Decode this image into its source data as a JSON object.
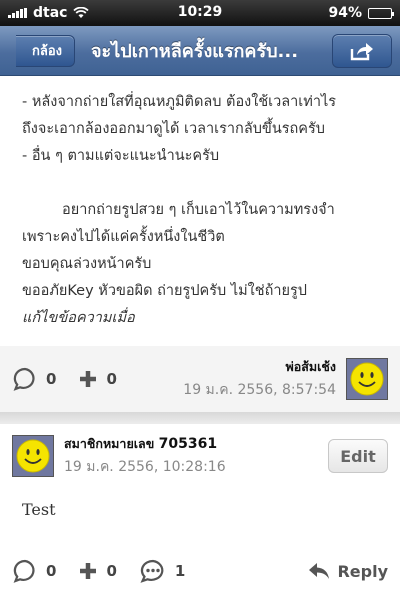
{
  "status_bar": {
    "carrier": "dtac",
    "time": "10:29",
    "battery": "94%",
    "battery_level": 0.94
  },
  "nav": {
    "back_label": "กล้อง",
    "title": "จะไปเกาหลีครั้งแรกครับ..."
  },
  "post": {
    "lines": [
      "- หลังจากถ่ายใสที่อุณหภูมิติดลบ ต้องใช้เวลาเท่าไร",
      "ถึงจะเอากล้องออกมาดูได้ เวลาเรากลับขึ้นรถครับ",
      "- อื่น ๆ ตามแต่จะแนะนำนะครับ"
    ],
    "lines2": [
      "อยากถ่ายรูปสวย ๆ เก็บเอาไว้ในความทรงจำ",
      "เพราะคงไปได้แค่ครั้งหนึ่งในชีวิต",
      "ขอบคุณล่วงหน้าครับ",
      "ขออภัยKey หัวขอผิด ถ่ายรูปครับ ไม่ใช่ถ้ายรูป"
    ],
    "edited_note": "แก้ไขข้อความเมื่อ",
    "comment_count": "0",
    "plus_count": "0",
    "author": "พ่อส้มเช้ง",
    "timestamp": "19 ม.ค. 2556, 8:57:54"
  },
  "comment": {
    "author_prefix": "สมาชิกหมายเลข",
    "author_number": "705361",
    "timestamp": "19 ม.ค. 2556, 10:28:16",
    "edit_label": "Edit",
    "text": "Test",
    "comment_count": "0",
    "plus_count": "0",
    "reply_count": "1",
    "reply_label": "Reply"
  },
  "colors": {
    "nav_blue": "#4c6d9e",
    "avatar_yellow": "#f5e400",
    "footer_bg": "#f4f4f4"
  },
  "icons": [
    "wifi-icon",
    "signal-icon",
    "battery-icon",
    "share-icon",
    "comment-bubble-icon",
    "plus-icon",
    "smiley-avatar-icon",
    "reply-arrow-icon"
  ]
}
